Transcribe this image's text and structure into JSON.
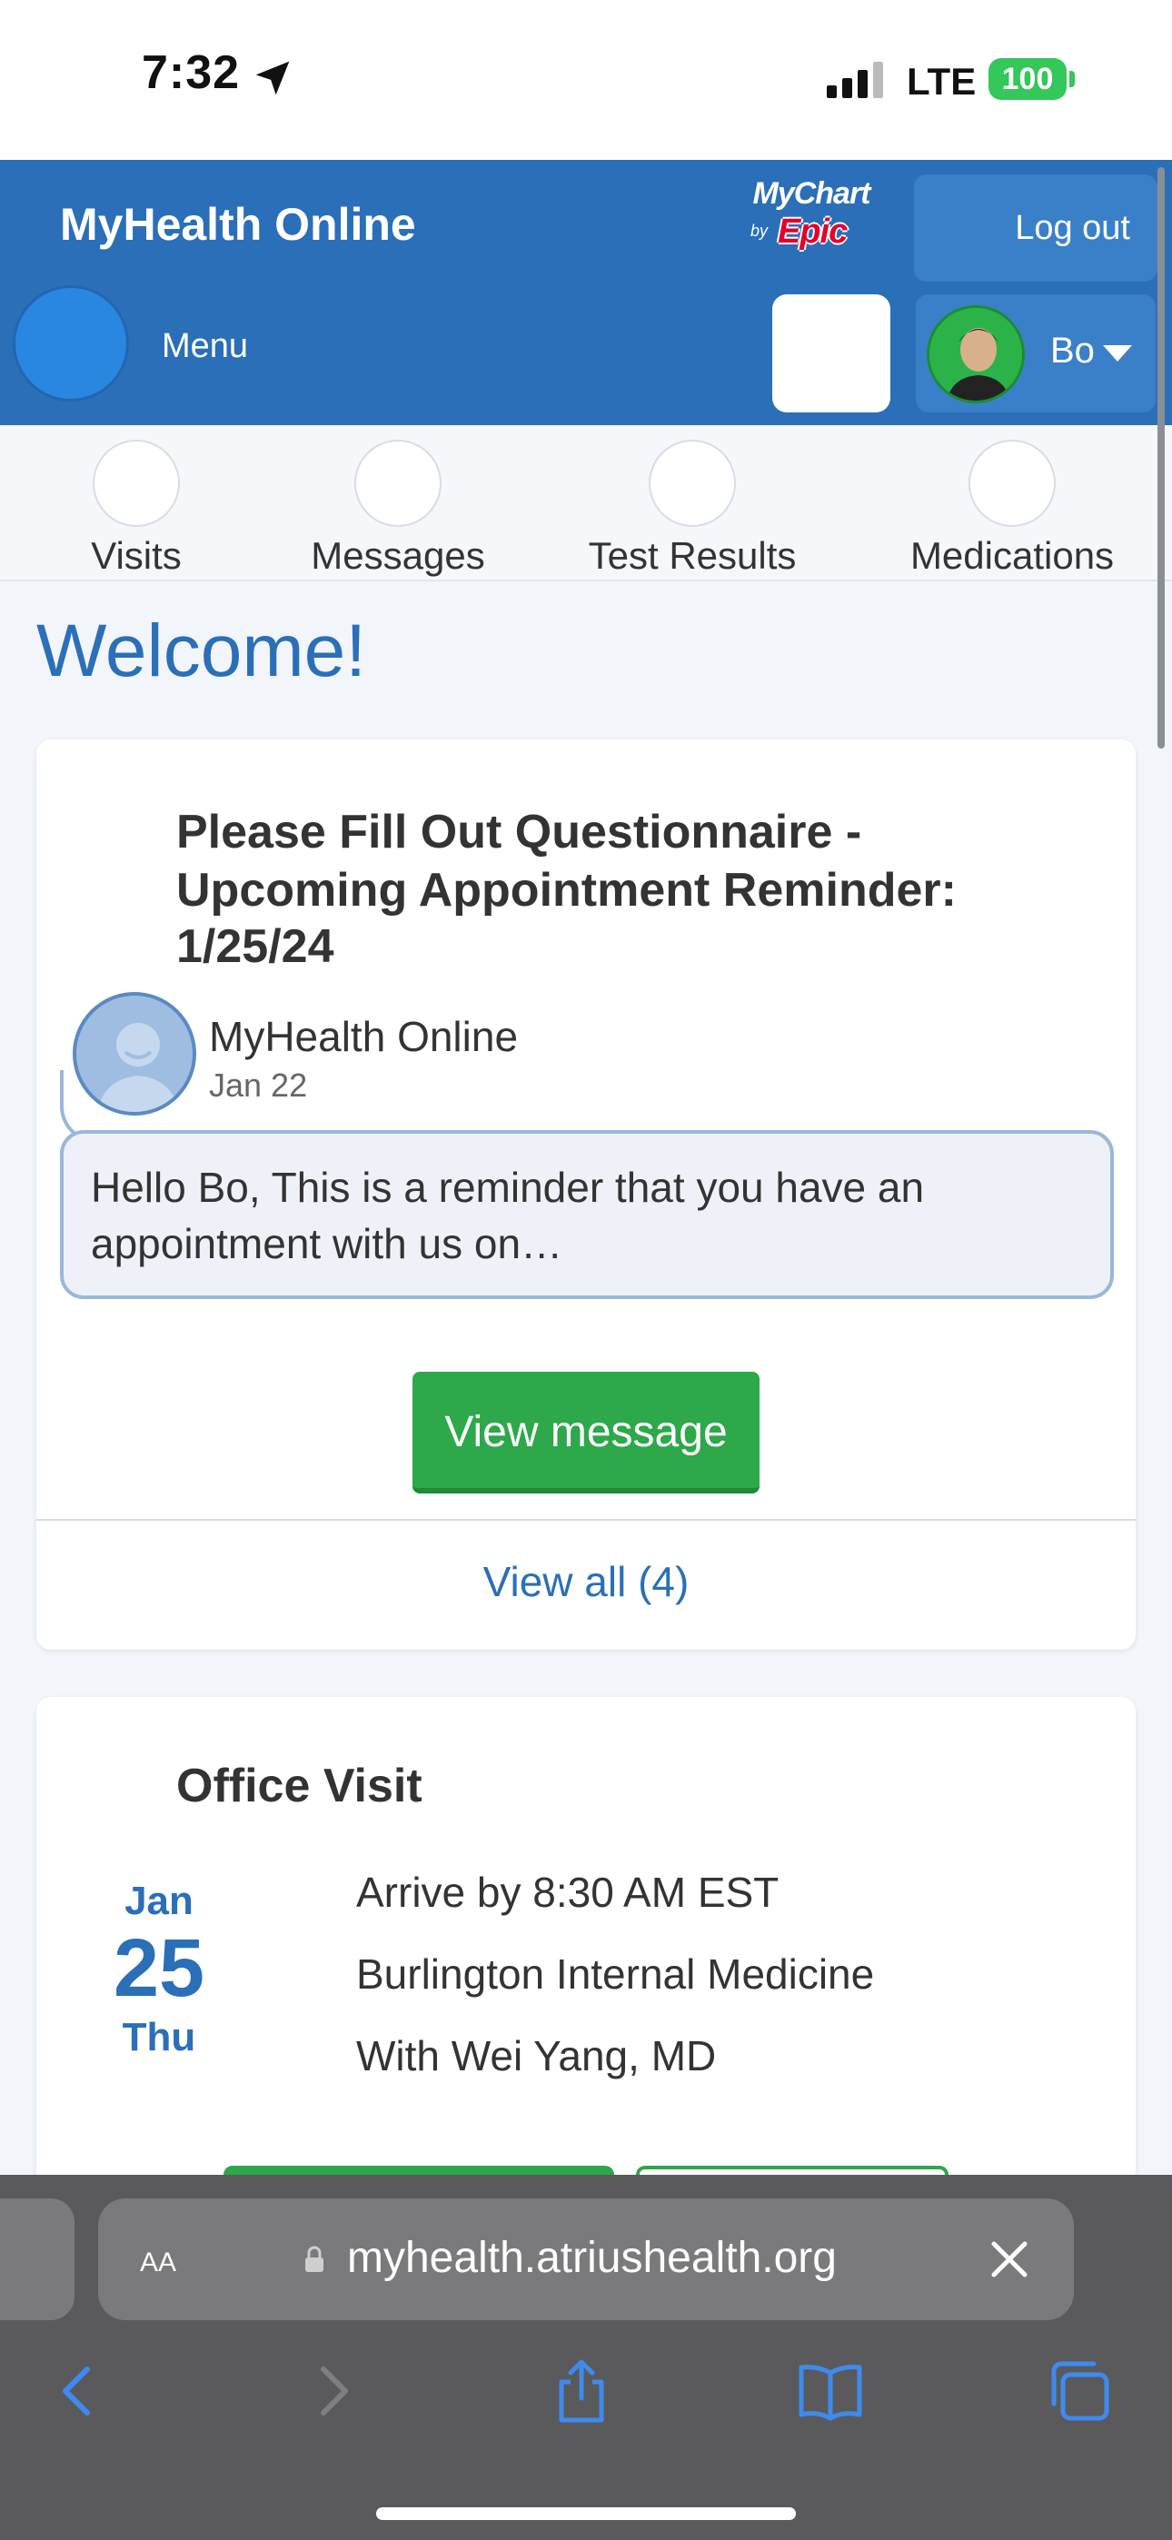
{
  "status_bar": {
    "time": "7:32",
    "network": "LTE",
    "battery": "100"
  },
  "header": {
    "app_title": "MyHealth Online",
    "logo": {
      "mychart": "MyChart",
      "by": "by",
      "epic": "Epic"
    },
    "logout_label": "Log out",
    "menu_label": "Menu",
    "user_name": "Bo"
  },
  "quick_nav": [
    {
      "label": "Visits"
    },
    {
      "label": "Messages"
    },
    {
      "label": "Test Results"
    },
    {
      "label": "Medications"
    }
  ],
  "welcome": "Welcome!",
  "message_card": {
    "title_line1": "Please Fill Out Questionnaire -",
    "title_line2": "Upcoming Appointment Reminder:",
    "title_line3": "1/25/24",
    "sender": "MyHealth Online",
    "date": "Jan 22",
    "preview_line1": "Hello Bo, This is a reminder that you have an",
    "preview_line2": "appointment with us on…",
    "view_button": "View message",
    "view_all": "View all (4)"
  },
  "visit_card": {
    "title": "Office Visit",
    "month": "Jan",
    "day": "25",
    "weekday": "Thu",
    "arrive": "Arrive by 8:30 AM EST",
    "location": "Burlington Internal Medicine",
    "provider": "With Wei Yang, MD"
  },
  "safari": {
    "text_size_label": "AA",
    "url": "myhealth.atriushealth.org"
  },
  "colors": {
    "brand_blue": "#2a6fb8",
    "action_green": "#2da84a",
    "battery_green": "#34c759"
  }
}
